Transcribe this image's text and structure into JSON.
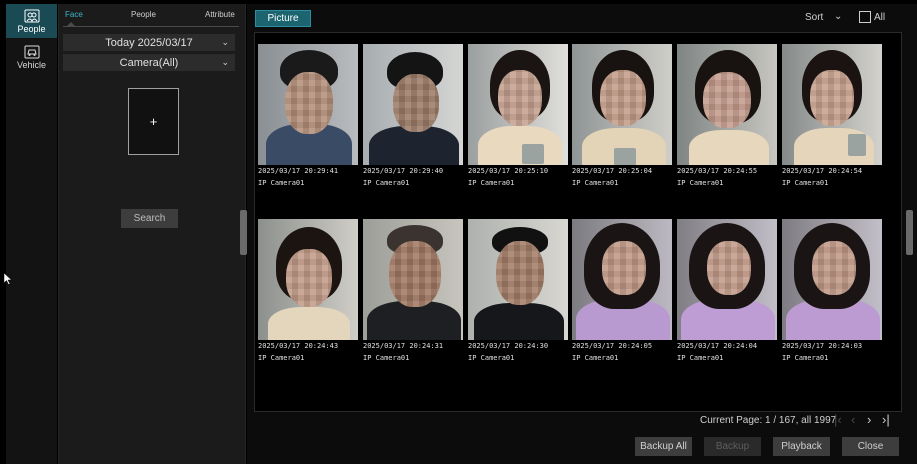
{
  "rail": {
    "items": [
      {
        "label": "People",
        "icon": "people-search-icon",
        "active": true
      },
      {
        "label": "Vehicle",
        "icon": "vehicle-icon",
        "active": false
      }
    ]
  },
  "filter": {
    "tabs": [
      "Face",
      "People",
      "Attribute"
    ],
    "active_tab": "Face",
    "date_value": "Today 2025/03/17",
    "camera_value": "Camera(All)",
    "add_symbol": "+",
    "search_label": "Search"
  },
  "main": {
    "view_tab": "Picture",
    "sort_label": "Sort",
    "all_label": "All",
    "results": [
      {
        "time": "2025/03/17 20:29:41",
        "camera": "IP Camera01"
      },
      {
        "time": "2025/03/17 20:29:40",
        "camera": "IP Camera01"
      },
      {
        "time": "2025/03/17 20:25:10",
        "camera": "IP Camera01"
      },
      {
        "time": "2025/03/17 20:25:04",
        "camera": "IP Camera01"
      },
      {
        "time": "2025/03/17 20:24:55",
        "camera": "IP Camera01"
      },
      {
        "time": "2025/03/17 20:24:54",
        "camera": "IP Camera01"
      },
      {
        "time": "2025/03/17 20:24:43",
        "camera": "IP Camera01"
      },
      {
        "time": "2025/03/17 20:24:31",
        "camera": "IP Camera01"
      },
      {
        "time": "2025/03/17 20:24:30",
        "camera": "IP Camera01"
      },
      {
        "time": "2025/03/17 20:24:05",
        "camera": "IP Camera01"
      },
      {
        "time": "2025/03/17 20:24:04",
        "camera": "IP Camera01"
      },
      {
        "time": "2025/03/17 20:24:03",
        "camera": "IP Camera01"
      }
    ],
    "pager_text": "Current Page: 1 / 167, all 1997",
    "buttons": {
      "backup_all": "Backup All",
      "backup": "Backup",
      "playback": "Playback",
      "close": "Close"
    }
  },
  "colors": {
    "accent": "#3db6c9",
    "active_tab_bg": "#1b6470"
  }
}
